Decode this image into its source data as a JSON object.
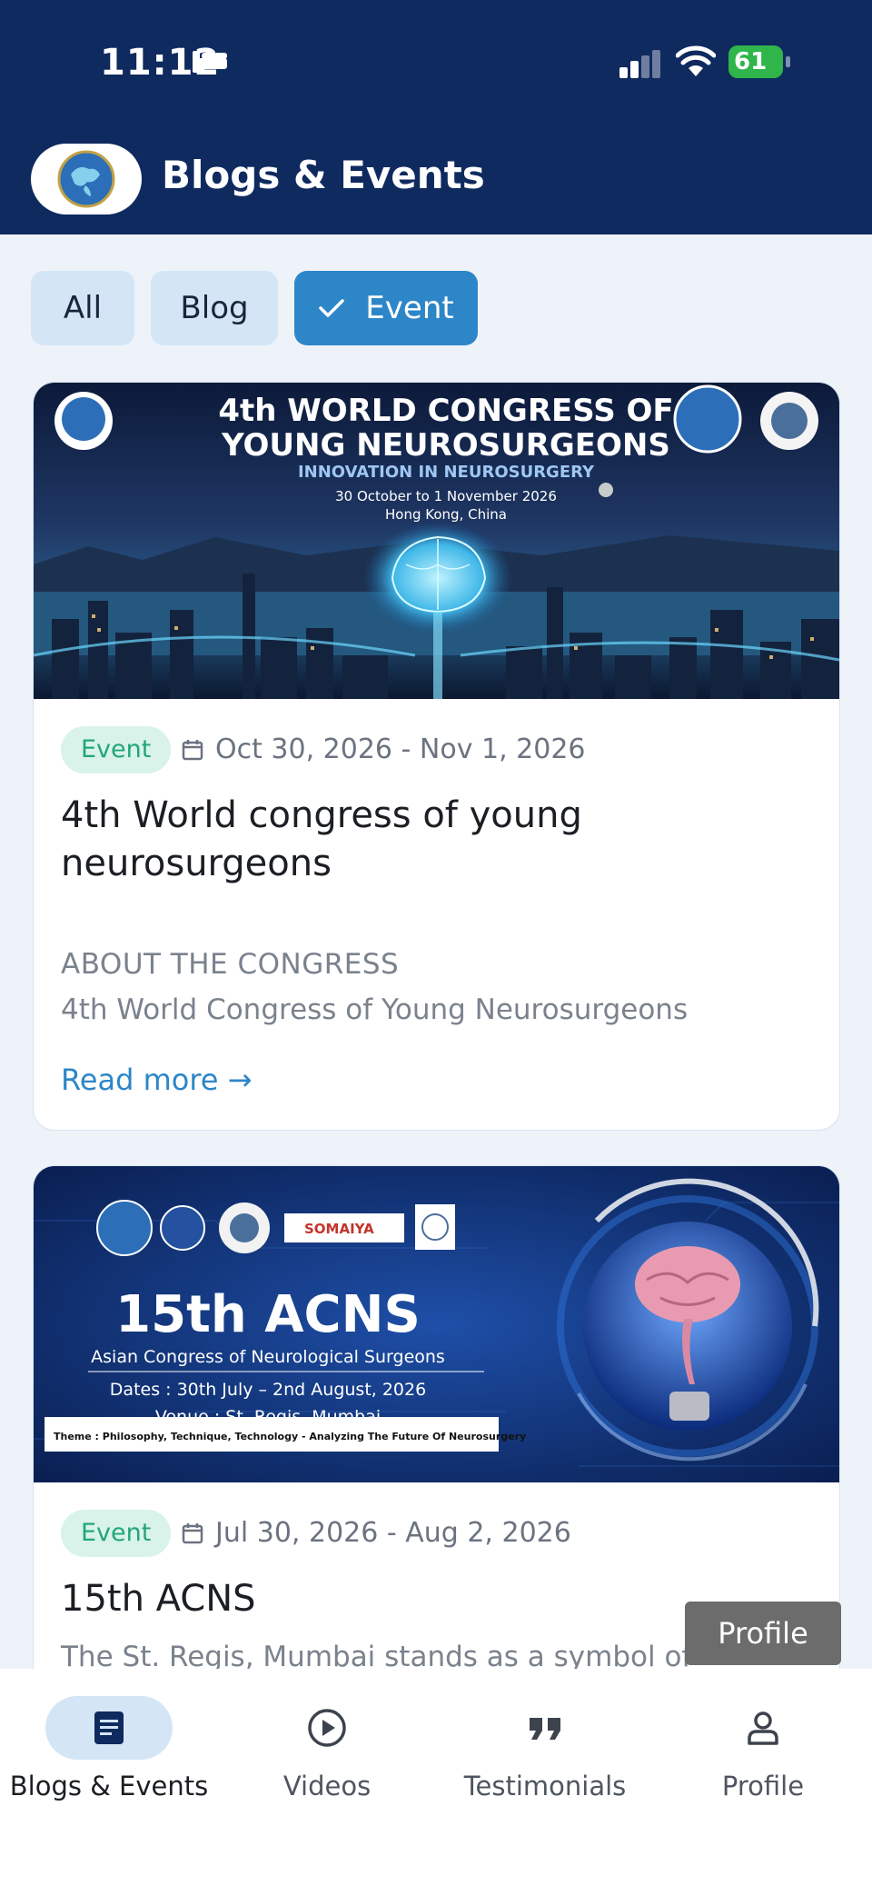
{
  "status_bar": {
    "time": "11:12",
    "battery": "61"
  },
  "app_bar": {
    "title": "Blogs & Events",
    "logo": "organization-logo"
  },
  "filters": [
    {
      "label": "All",
      "selected": false
    },
    {
      "label": "Blog",
      "selected": false
    },
    {
      "label": "Event",
      "selected": true
    }
  ],
  "cards": [
    {
      "banner": {
        "headline_line1": "4th WORLD CONGRESS OF",
        "headline_line2": "YOUNG NEUROSURGEONS",
        "tagline": "INNOVATION IN NEUROSURGERY",
        "dates": "30 October to 1 November 2026",
        "location": "Hong Kong, China"
      },
      "badge": "Event",
      "date_range": "Oct 30, 2026 - Nov 1, 2026",
      "title": "4th World congress of young neurosurgeons",
      "subtitle": "ABOUT THE CONGRESS",
      "description": "4th World Congress of Young Neurosurgeons",
      "read_more": "Read more →"
    },
    {
      "banner": {
        "headline": "15th ACNS",
        "subline": "Asian Congress of Neurological Surgeons",
        "dates": "Dates : 30th July – 2nd August, 2026",
        "venue": "Venue : St. Regis, Mumbai",
        "theme": "Theme : Philosophy, Technique, Technology - Analyzing The Future Of Neurosurgery",
        "sponsor": "SOMAIYA"
      },
      "badge": "Event",
      "date_range": "Jul 30, 2026 - Aug 2, 2026",
      "title": "15th ACNS",
      "description": "The St. Regis, Mumbai stands as a symbol of"
    }
  ],
  "tooltip": "Profile",
  "bottom_nav": [
    {
      "label": "Blogs & Events",
      "icon": "article-icon",
      "active": true
    },
    {
      "label": "Videos",
      "icon": "play-circle-icon",
      "active": false
    },
    {
      "label": "Testimonials",
      "icon": "quote-icon",
      "active": false
    },
    {
      "label": "Profile",
      "icon": "person-icon",
      "active": false
    }
  ],
  "colors": {
    "navy": "#0f2a5f",
    "accent": "#2d86c8",
    "badge_bg": "#d9f3ea",
    "badge_text": "#22a67a"
  }
}
